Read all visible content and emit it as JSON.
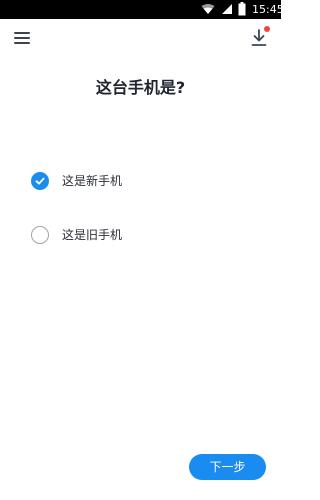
{
  "status_bar": {
    "time": "15:45",
    "icons": [
      "wifi-icon",
      "signal-icon",
      "battery-icon"
    ]
  },
  "app_bar": {
    "left_icon": "menu-icon",
    "right_icon": "download-icon",
    "badge_color": "#f2453d"
  },
  "question": {
    "title": "这台手机是?"
  },
  "options": [
    {
      "label": "这是新手机",
      "selected": true
    },
    {
      "label": "这是旧手机",
      "selected": false
    }
  ],
  "next_button": {
    "label": "下一步"
  },
  "colors": {
    "accent": "#1a8cf0",
    "text": "#1f2430",
    "icon": "#3c4454"
  }
}
